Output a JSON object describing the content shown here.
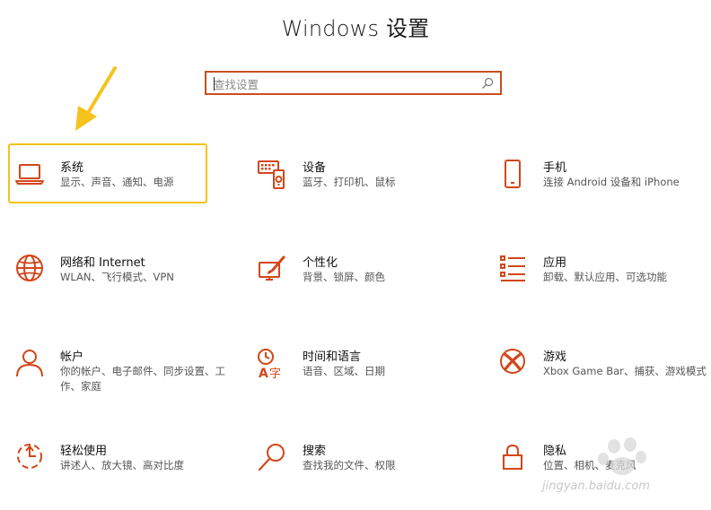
{
  "window": {
    "title": "Windows 设置"
  },
  "search": {
    "placeholder": "查找设置"
  },
  "colors": {
    "accent": "#c74f1f",
    "icon": "#d3461a",
    "highlight": "#f2c21a"
  },
  "tiles": [
    {
      "title": "系统",
      "desc": "显示、声音、通知、电源",
      "icon": "laptop-icon"
    },
    {
      "title": "设备",
      "desc": "蓝牙、打印机、鼠标",
      "icon": "devices-icon"
    },
    {
      "title": "手机",
      "desc": "连接 Android 设备和 iPhone",
      "icon": "phone-icon"
    },
    {
      "title": "网络和 Internet",
      "desc": "WLAN、飞行模式、VPN",
      "icon": "globe-icon"
    },
    {
      "title": "个性化",
      "desc": "背景、锁屏、颜色",
      "icon": "paint-icon"
    },
    {
      "title": "应用",
      "desc": "卸载、默认应用、可选功能",
      "icon": "apps-list-icon"
    },
    {
      "title": "帐户",
      "desc": "你的帐户、电子邮件、同步设置、工作、家庭",
      "icon": "person-icon"
    },
    {
      "title": "时间和语言",
      "desc": "语音、区域、日期",
      "icon": "time-language-icon"
    },
    {
      "title": "游戏",
      "desc": "Xbox Game Bar、捕获、游戏模式",
      "icon": "xbox-icon"
    },
    {
      "title": "轻松使用",
      "desc": "讲述人、放大镜、高对比度",
      "icon": "ease-of-access-icon"
    },
    {
      "title": "搜索",
      "desc": "查找我的文件、权限",
      "icon": "search-icon"
    },
    {
      "title": "隐私",
      "desc": "位置、相机、麦克风",
      "icon": "lock-icon"
    }
  ],
  "watermark": {
    "text": "jingyan.baidu.com"
  }
}
